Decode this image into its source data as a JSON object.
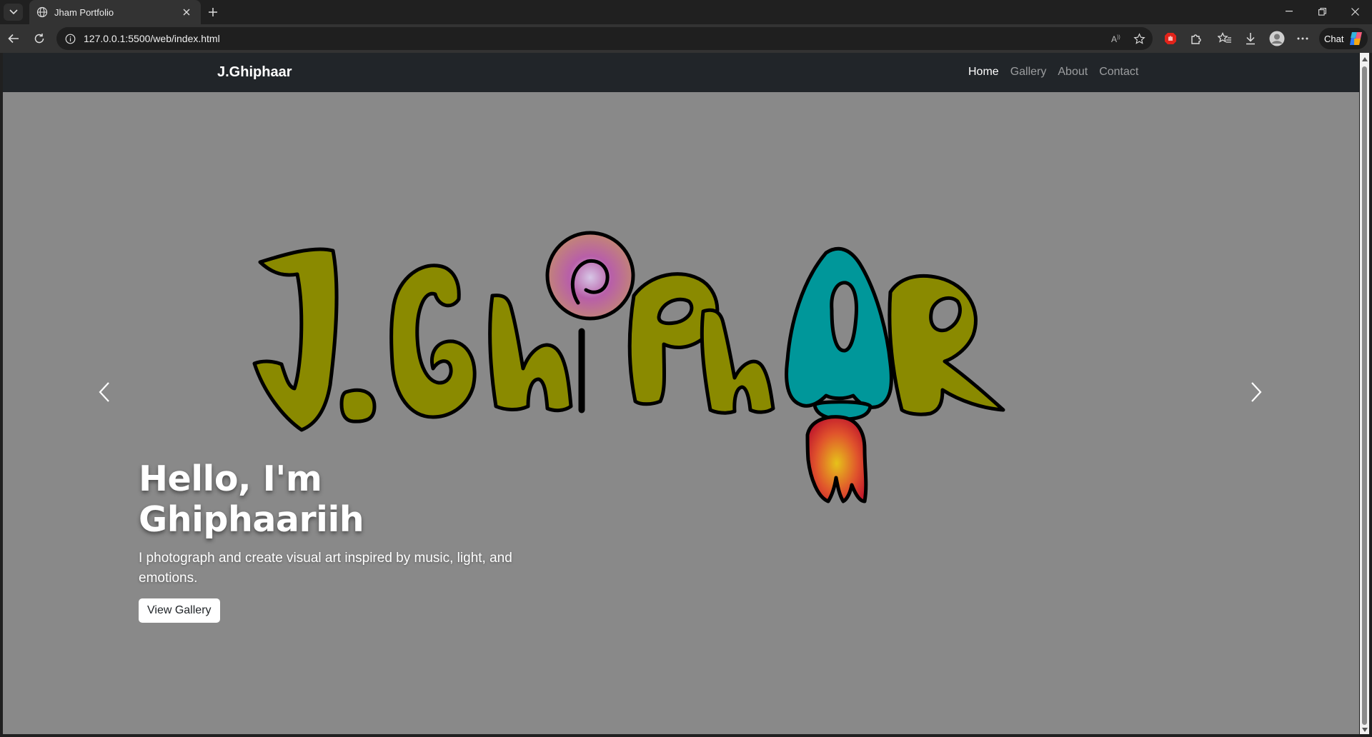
{
  "browser": {
    "tab_title": "Jham Portfolio",
    "url": "127.0.0.1:5500/web/index.html",
    "chat_label": "Chat"
  },
  "site": {
    "brand": "J.Ghiphaar",
    "nav": [
      {
        "label": "Home",
        "active": true
      },
      {
        "label": "Gallery",
        "active": false
      },
      {
        "label": "About",
        "active": false
      },
      {
        "label": "Contact",
        "active": false
      }
    ]
  },
  "hero": {
    "heading": "Hello, I'm Ghiphaariih",
    "subtitle": "I photograph and create visual art inspired by music, light, and emotions.",
    "button_label": "View Gallery",
    "logo_art_text": "J.GhiPhaR"
  },
  "colors": {
    "olive": "#8a8a00",
    "teal": "#00979a",
    "page_bg": "#898989",
    "navbar": "#212529"
  }
}
